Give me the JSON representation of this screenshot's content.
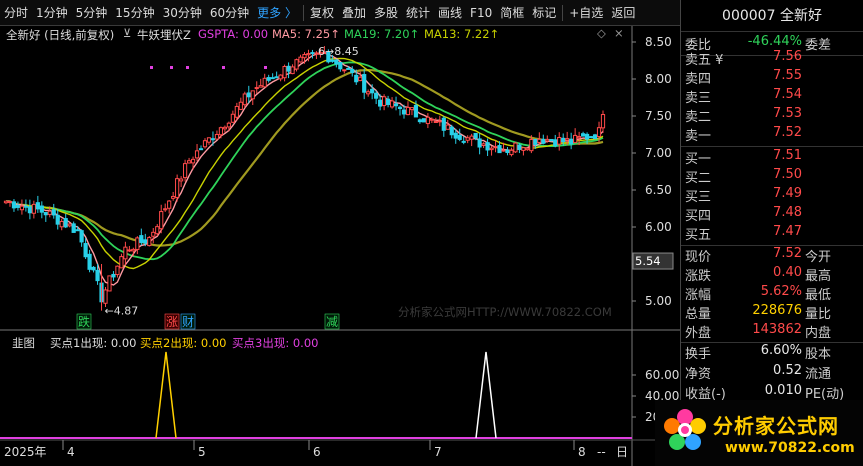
{
  "toolbar": {
    "items": [
      "分时",
      "1分钟",
      "5分钟",
      "15分钟",
      "30分钟",
      "60分钟",
      "更多 〉",
      "复权",
      "叠加",
      "多股",
      "统计",
      "画线",
      "F10",
      "简框",
      "标记",
      "+自选",
      "返回"
    ]
  },
  "chart": {
    "title": "全新好 (日线,前复权)",
    "indicator_name": "牛妖埋伏Z",
    "gspta": "GSPTA: 0.00",
    "ma5": "MA5: 7.25↑",
    "ma19": "MA19: 7.20↑",
    "ma13": "MA13: 7.22↑",
    "high_marker": "8.45",
    "low_marker": "4.87",
    "current_price_tag": "5.54",
    "watermark": "分析家公式网HTTP://WWW.70822.COM",
    "event_labels": [
      {
        "text": "跌",
        "color": "#2fd35a"
      },
      {
        "text": "涨",
        "color": "#ff4a4a"
      },
      {
        "text": "财",
        "color": "#2fa3ff"
      },
      {
        "text": "减",
        "color": "#2fd35a"
      }
    ],
    "y_ticks": [
      "8.50",
      "8.00",
      "7.50",
      "7.00",
      "6.50",
      "6.00",
      "5.50",
      "5.00"
    ],
    "x_labels": [
      "2025年",
      "4",
      "5",
      "6",
      "7",
      "8",
      "--",
      "日"
    ],
    "colors": {
      "up": "#ff4a4a",
      "down": "#28d0e8",
      "ma5": "#ff9aa2",
      "ma13": "#c8d200",
      "ma19": "#2fd35a",
      "ma_gold": "#a09a20"
    }
  },
  "sub": {
    "name": "韭图",
    "buy1": "买点1出现: 0.00",
    "buy2": "买点2出现: 0.00",
    "buy3": "买点3出现: 0.00",
    "y_ticks": [
      "60.00",
      "40.00",
      "20"
    ]
  },
  "panel": {
    "code": "000007",
    "name": "全新好",
    "weibi_label": "委比",
    "weibi_value": "-46.44%",
    "weicha_label": "委差",
    "sell": [
      {
        "label": "卖五 ¥",
        "price": "7.56"
      },
      {
        "label": "卖四",
        "price": "7.55"
      },
      {
        "label": "卖三",
        "price": "7.54"
      },
      {
        "label": "卖二",
        "price": "7.53"
      },
      {
        "label": "卖一",
        "price": "7.52"
      }
    ],
    "buy": [
      {
        "label": "买一",
        "price": "7.51"
      },
      {
        "label": "买二",
        "price": "7.50"
      },
      {
        "label": "买三",
        "price": "7.49"
      },
      {
        "label": "买四",
        "price": "7.48"
      },
      {
        "label": "买五",
        "price": "7.47"
      }
    ],
    "quote": [
      {
        "label": "现价",
        "value": "7.52",
        "label2": "今开"
      },
      {
        "label": "涨跌",
        "value": "0.40",
        "label2": "最高"
      },
      {
        "label": "涨幅",
        "value": "5.62%",
        "label2": "最低"
      },
      {
        "label": "总量",
        "value": "228676",
        "label2": "量比"
      },
      {
        "label": "外盘",
        "value": "143862",
        "label2": "内盘"
      }
    ],
    "stats": [
      {
        "label": "换手",
        "value": "6.60%",
        "label2": "股本"
      },
      {
        "label": "净资",
        "value": "0.52",
        "label2": "流通"
      },
      {
        "label": "收益(-)",
        "value": "0.010",
        "label2": "PE(动)"
      }
    ]
  },
  "logo": {
    "text": "分析家公式网",
    "url": "www.70822.com"
  }
}
